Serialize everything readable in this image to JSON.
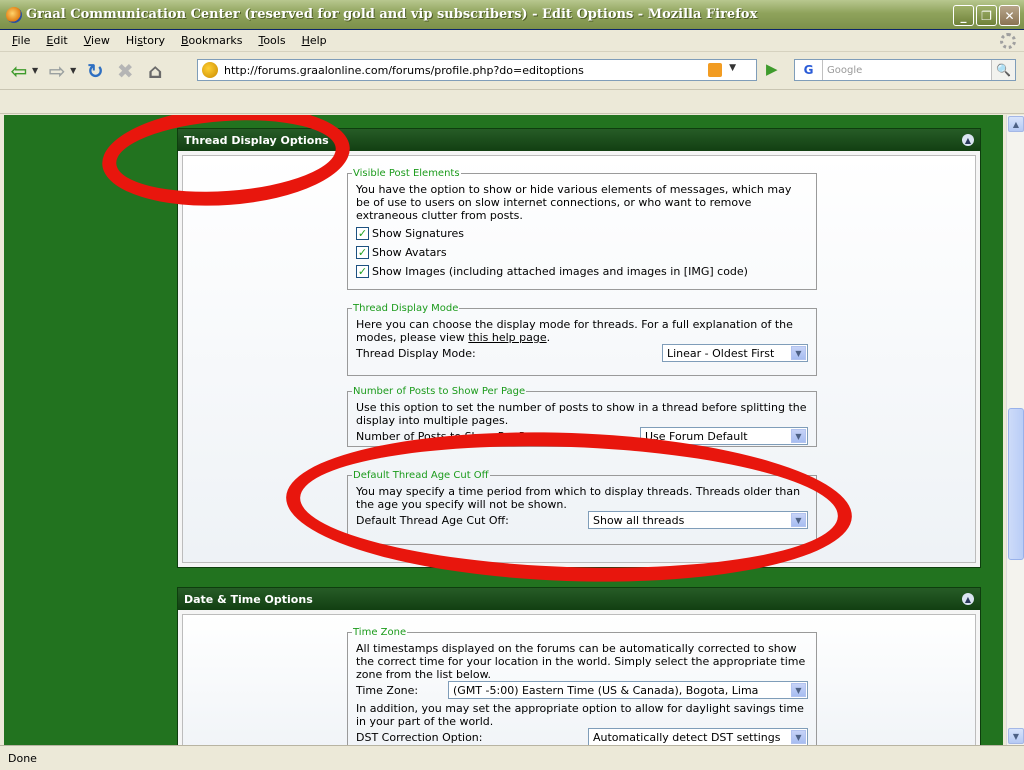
{
  "window": {
    "title": "Graal Communication Center (reserved for gold and vip subscribers) - Edit Options - Mozilla Firefox",
    "minimize": "_",
    "maximize": "❐",
    "close": "✕"
  },
  "menu": {
    "items": [
      {
        "key": "F",
        "rest": "ile"
      },
      {
        "key": "E",
        "rest": "dit"
      },
      {
        "key": "V",
        "rest": "iew"
      },
      {
        "key": "",
        "rest": "Hi",
        "key2": "s",
        "rest2": "tory"
      },
      {
        "key": "B",
        "rest": "ookmarks"
      },
      {
        "key": "T",
        "rest": "ools"
      },
      {
        "key": "H",
        "rest": "elp"
      }
    ]
  },
  "nav": {
    "url": "http://forums.graalonline.com/forums/profile.php?do=editoptions",
    "search_placeholder": "Google",
    "search_engine": "G"
  },
  "thread_display": {
    "header": "Thread Display Options",
    "visible_post": {
      "legend": "Visible Post Elements",
      "description": "You have the option to show or hide various elements of messages, which may be of use to users on slow internet connections, or who want to remove extraneous clutter from posts.",
      "options": [
        "Show Signatures",
        "Show Avatars",
        "Show Images (including attached images and images in [IMG] code)"
      ]
    },
    "display_mode": {
      "legend": "Thread Display Mode",
      "description_pre": "Here you can choose the display mode for threads. For a full explanation of the modes, please view ",
      "link": "this help page",
      "description_post": ".",
      "label": "Thread Display Mode:",
      "value": "Linear - Oldest First"
    },
    "posts_per_page": {
      "legend": "Number of Posts to Show Per Page",
      "description": "Use this option to set the number of posts to show in a thread before splitting the display into multiple pages.",
      "label": "Number of Posts to Show Per Page:",
      "value": "Use Forum Default"
    },
    "age_cutoff": {
      "legend": "Default Thread Age Cut Off",
      "description": "You may specify a time period from which to display threads. Threads older than the age you specify will not be shown.",
      "label": "Default Thread Age Cut Off:",
      "value": "Show all threads"
    }
  },
  "date_time": {
    "header": "Date & Time Options",
    "time_zone": {
      "legend": "Time Zone",
      "description": "All timestamps displayed on the forums can be automatically corrected to show the correct time for your location in the world. Simply select the appropriate time zone from the list below.",
      "label": "Time Zone:",
      "value": "(GMT -5:00) Eastern Time (US & Canada), Bogota, Lima",
      "dst_description": "In addition, you may set the appropriate option to allow for daylight savings time in your part of the world.",
      "dst_label": "DST Correction Option:",
      "dst_value": "Automatically detect DST settings"
    }
  },
  "status": {
    "text": "Done"
  },
  "colors": {
    "page_background": "#22731f",
    "section_header": "#1a4d1a",
    "legend_text": "#1c9b1c",
    "annotation": "#e8160d"
  }
}
